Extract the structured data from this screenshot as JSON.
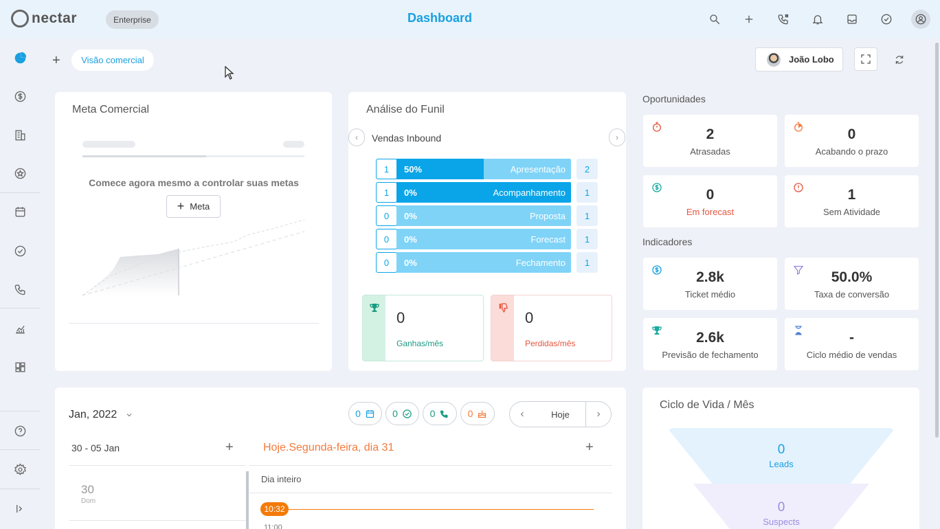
{
  "brand": {
    "name": "nectar",
    "plan_badge": "Enterprise"
  },
  "header": {
    "title": "Dashboard",
    "icons": [
      "search-icon",
      "plus-icon",
      "phone-dialpad-icon",
      "bell-icon",
      "inbox-icon",
      "check-circle-icon",
      "user-circle-icon"
    ]
  },
  "sidebar": {
    "items": [
      "pie-chart-icon",
      "dollar-icon",
      "building-icon",
      "star-icon",
      "calendar-icon",
      "check-circle-icon",
      "phone-icon",
      "chart-icon",
      "dashboard-icon",
      "help-icon",
      "settings-icon",
      "collapse-icon"
    ]
  },
  "toolbar": {
    "add_label": "+",
    "dashboard_tab": "Visão comercial",
    "user_name": "João Lobo"
  },
  "meta_comercial": {
    "title": "Meta Comercial",
    "empty_text": "Comece agora mesmo a controlar suas metas",
    "add_button": "Meta"
  },
  "funil": {
    "title": "Análise do Funil",
    "pipeline": "Vendas Inbound",
    "stages": [
      {
        "count": "1",
        "pct": "50%",
        "fill": 0.5,
        "name": "Apresentação",
        "right": "2"
      },
      {
        "count": "1",
        "pct": "0%",
        "fill": 1.0,
        "name": "Acompanhamento",
        "right": "1"
      },
      {
        "count": "0",
        "pct": "0%",
        "fill": 0,
        "name": "Proposta",
        "right": "1"
      },
      {
        "count": "0",
        "pct": "0%",
        "fill": 0,
        "name": "Forecast",
        "right": "1"
      },
      {
        "count": "0",
        "pct": "0%",
        "fill": 0,
        "name": "Fechamento",
        "right": "1"
      }
    ],
    "won": {
      "value": "0",
      "label": "Ganhas/mês",
      "color": "#1a9b80"
    },
    "lost": {
      "value": "0",
      "label": "Perdidas/mês",
      "color": "#e5553f"
    }
  },
  "oportunidades": {
    "title": "Oportunidades",
    "items": [
      {
        "value": "2",
        "label": "Atrasadas",
        "icon": "stopwatch-icon"
      },
      {
        "value": "0",
        "label": "Acabando o prazo",
        "icon": "timer-icon"
      },
      {
        "value": "0",
        "label": "Em forecast",
        "icon": "dollar-icon"
      },
      {
        "value": "1",
        "label": "Sem Atividade",
        "icon": "alert-icon"
      }
    ]
  },
  "indicadores": {
    "title": "Indicadores",
    "items": [
      {
        "value": "2.8k",
        "label": "Ticket médio",
        "icon": "dollar-icon"
      },
      {
        "value": "50.0%",
        "label": "Taxa de conversão",
        "icon": "funnel-icon"
      },
      {
        "value": "2.6k",
        "label": "Previsão de fechamento",
        "icon": "trophy-icon"
      },
      {
        "value": "-",
        "label": "Ciclo médio de vendas",
        "icon": "hourglass-icon"
      }
    ]
  },
  "agenda": {
    "month": "Jan, 2022",
    "pills": [
      {
        "value": "0",
        "icon": "calendar-icon",
        "color": "#19a0e0"
      },
      {
        "value": "0",
        "icon": "check-circle-icon",
        "color": "#1a9b80"
      },
      {
        "value": "0",
        "icon": "phone-icon",
        "color": "#1a9b80"
      },
      {
        "value": "0",
        "icon": "cake-icon",
        "color": "#f47a3c"
      }
    ],
    "today_button": "Hoje",
    "week_range": "30 - 05 Jan",
    "today_heading": "Hoje.Segunda-feira, dia 31",
    "day_number": "30",
    "day_name": "Dom",
    "all_day": "Dia inteiro",
    "now_time": "10:32",
    "next_time": "11:00"
  },
  "ciclo_vida": {
    "title": "Ciclo de Vida / Mês",
    "levels": [
      {
        "value": "0",
        "label": "Leads",
        "color": "#19a0e0"
      },
      {
        "value": "0",
        "label": "Suspects",
        "color": "#9b8be0"
      }
    ]
  }
}
